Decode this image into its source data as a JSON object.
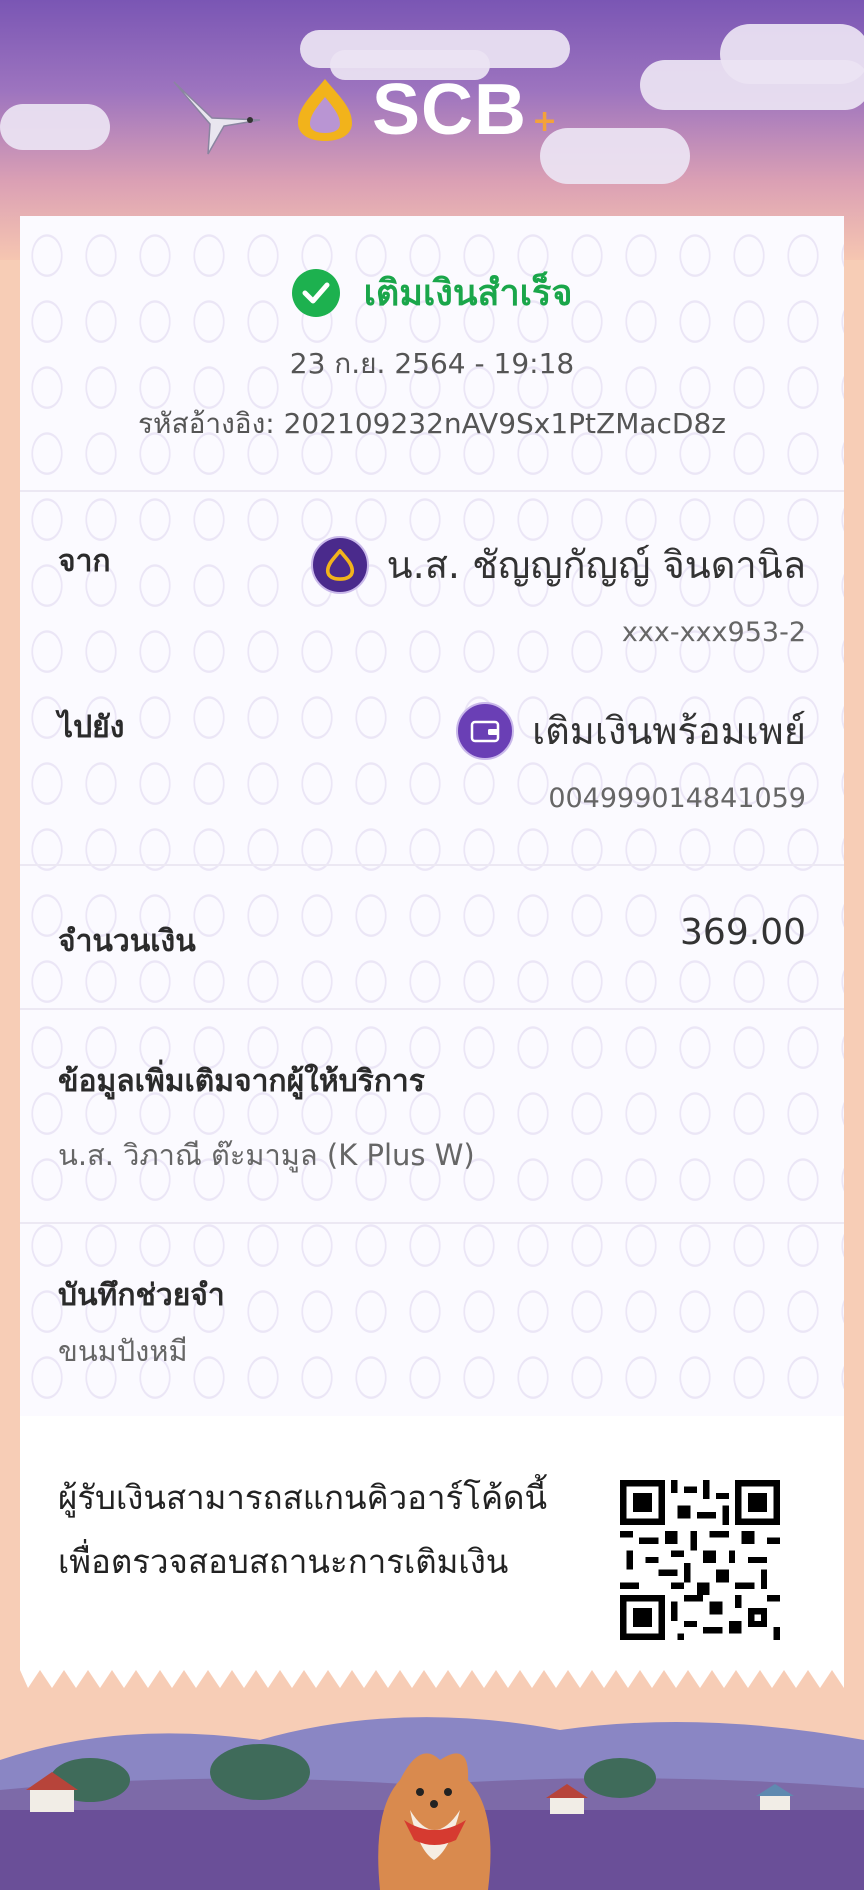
{
  "header": {
    "logo_text": "SCB",
    "logo_plus": "+"
  },
  "status": {
    "title": "เติมเงินสำเร็จ",
    "datetime": "23 ก.ย. 2564 - 19:18",
    "reference": "รหัสอ้างอิง: 202109232nAV9Sx1PtZMacD8z",
    "color": "#1aa64a"
  },
  "from": {
    "label": "จาก",
    "name": "น.ส. ชัญญกัญญ์ จินดานิล",
    "account": "xxx-xxx953-2",
    "icon": "scb-bank-icon"
  },
  "to": {
    "label": "ไปยัง",
    "name": "เติมเงินพร้อมเพย์",
    "account": "004999014841059",
    "icon": "wallet-icon"
  },
  "amount": {
    "label": "จำนวนเงิน",
    "value": "369.00"
  },
  "provider_info": {
    "label": "ข้อมูลเพิ่มเติมจากผู้ให้บริการ",
    "value": "น.ส. วิภาณี ต๊ะมามูล (K Plus W)"
  },
  "memo": {
    "label": "บันทึกช่วยจำ",
    "value": "ขนมปังหมี"
  },
  "qr": {
    "line1": "ผู้รับเงินสามารถสแกนคิวอาร์โค้ดนี้",
    "line2": "เพื่อตรวจสอบสถานะการเติมเงิน"
  },
  "colors": {
    "brand_purple": "#4a2a8c",
    "success_green": "#1db14f"
  }
}
